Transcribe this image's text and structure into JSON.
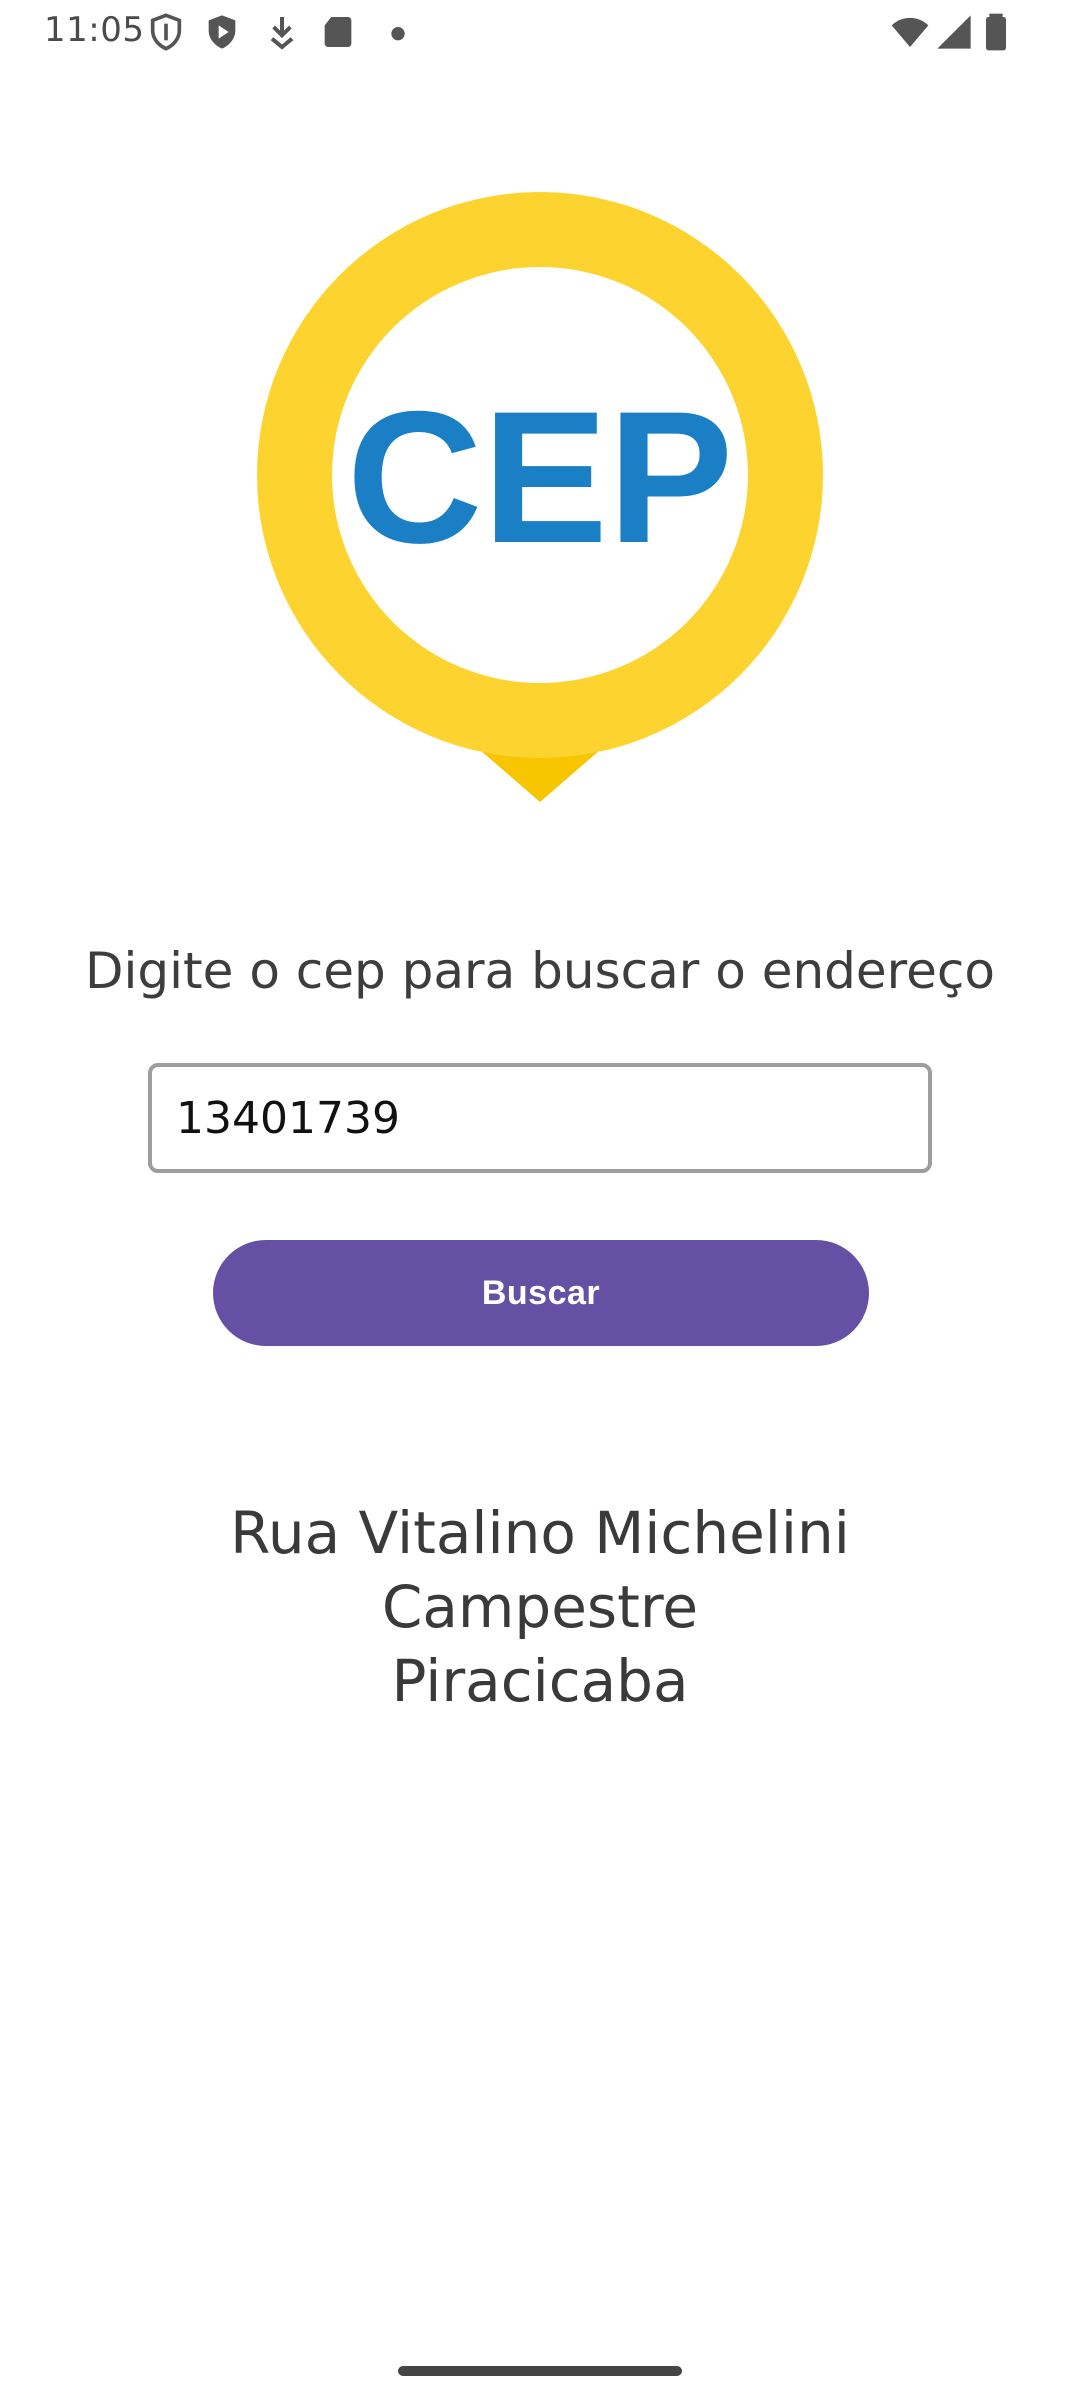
{
  "status_bar": {
    "time": "11:05",
    "left_icons": [
      "shield-outline-icon",
      "shield-play-icon",
      "download-arrow-icon",
      "sd-card-icon",
      "dot-icon"
    ],
    "right_icons": [
      "wifi-icon",
      "cellular-signal-icon",
      "battery-icon"
    ]
  },
  "logo": {
    "text": "CEP",
    "colors": {
      "ring": "#fdd42f",
      "pointer": "#f7c600",
      "letters": "#1a7fc4"
    }
  },
  "form": {
    "prompt": "Digite o cep para buscar o endereço",
    "cep_value": "13401739",
    "cep_placeholder": "",
    "search_label": "Buscar"
  },
  "result": {
    "street": "Rua Vitalino Michelini",
    "neighborhood": "Campestre",
    "city": "Piracicaba"
  },
  "theme": {
    "primary": "#6650a4",
    "input_border": "#9e9e9e",
    "text": "#3a3a3a"
  }
}
